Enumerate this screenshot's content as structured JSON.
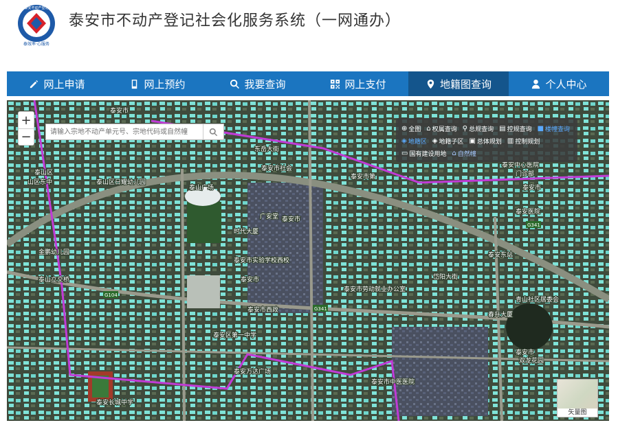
{
  "header": {
    "title": "泰安市不动产登记社会化服务系统（一网通办）",
    "logo_text_top": "泰安不动产登记",
    "logo_text_bottom": "泰效率·心服务"
  },
  "nav": {
    "items": [
      {
        "label": "网上申请",
        "icon": "pencil-icon"
      },
      {
        "label": "网上预约",
        "icon": "mobile-icon"
      },
      {
        "label": "我要查询",
        "icon": "search-icon"
      },
      {
        "label": "网上支付",
        "icon": "qrcode-icon"
      },
      {
        "label": "地籍图查询",
        "icon": "map-marker-icon"
      },
      {
        "label": "个人中心",
        "icon": "user-icon"
      }
    ],
    "active_index": 4
  },
  "map": {
    "zoom_in": "+",
    "zoom_out": "−",
    "search_placeholder": "请输入宗地不动产单元号、宗地代码或自然幢",
    "toolbox": {
      "row1": [
        {
          "label": "全图",
          "icon": "globe-icon"
        },
        {
          "label": "权属查询",
          "icon": "home-icon"
        },
        {
          "label": "总规查询",
          "icon": "search-icon"
        },
        {
          "label": "控规查询",
          "icon": "doc-icon"
        },
        {
          "label": "楼幢查询",
          "icon": "building-icon",
          "highlight": true
        }
      ],
      "row2": [
        {
          "label": "地籍区",
          "icon": "layers-icon",
          "highlight": true
        },
        {
          "label": "地籍子区",
          "icon": "layers-icon"
        },
        {
          "label": "总体规划",
          "icon": "plan-icon"
        },
        {
          "label": "控制规划",
          "icon": "chart-icon"
        }
      ],
      "row3": [
        {
          "label": "国有建设用地",
          "icon": "land-icon"
        },
        {
          "label": "自然幢",
          "icon": "house-icon",
          "selected": true
        }
      ]
    },
    "minimap_label": "矢量图",
    "labels": [
      "泰安市",
      "东岳大街",
      "泰安市社会",
      "泰安市第",
      "泰安中心医院",
      "门诊部",
      "泰安市",
      "泰安医院",
      "泰山区日耀幼儿园",
      "泰山区",
      "山区东中",
      "泰山广场",
      "广安堂",
      "泰安市",
      "时代大厦",
      "泰安市实验学校西校",
      "金鹏幼儿园",
      "泰山立交桥",
      "泰安市",
      "泰安市劳动就业办公室",
      "岱阳大街",
      "春升大厦",
      "青山社区居委会",
      "泰安市西政",
      "泰安长城中学",
      "泰安市中医医院",
      "泰安万达广场",
      "泰安区第一中学",
      "泰安东站",
      "泰安市",
      "双龙花园"
    ],
    "road_codes": [
      "G341",
      "G104",
      "G341"
    ]
  },
  "colors": {
    "nav_bg": "#1b75c0",
    "nav_active": "#14558c",
    "building": "#7fe3d8",
    "boundary": "#c03bd6"
  }
}
